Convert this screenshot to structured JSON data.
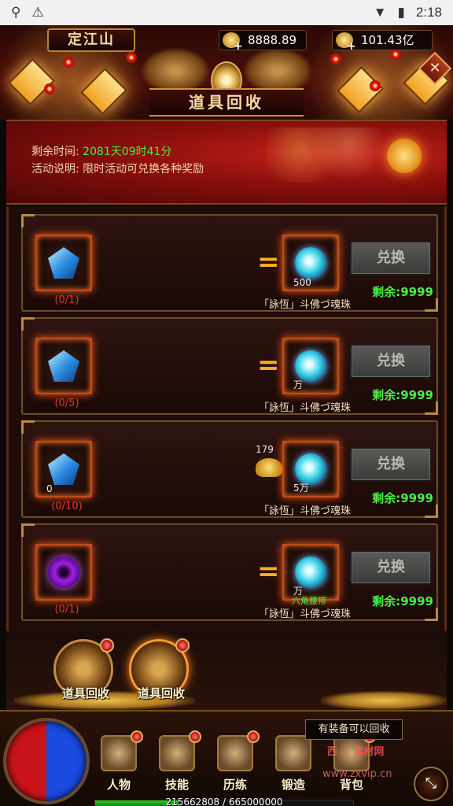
{
  "status_bar": {
    "time": "2:18"
  },
  "header": {
    "server_name": "定江山",
    "currency_1": "8888.89",
    "currency_2": "101.43亿",
    "title": "道具回收",
    "close_glyph": "✕"
  },
  "info": {
    "time_label": "剩余时间:",
    "time_value": "2081天09时41分",
    "desc_label": "活动说明:",
    "desc_value": "限时活动可兑换各种奖励"
  },
  "items": [
    {
      "need": "(0/1)",
      "gem": "gem-blue",
      "slot_qty": "",
      "reward_qty": "500",
      "reward_name": "「詠恆」斗佛づ魂珠",
      "button": "兑换",
      "remain": "剩余:9999"
    },
    {
      "need": "(0/5)",
      "gem": "gem-blue",
      "slot_qty": "",
      "reward_qty": "万",
      "reward_name": "「詠恆」斗佛づ魂珠",
      "button": "兑换",
      "remain": "剩余:9999"
    },
    {
      "need": "(0/10)",
      "gem": "gem-blue",
      "slot_qty": "0",
      "reward_qty": "5万",
      "reward_name": "「詠恆」斗佛づ魂珠",
      "button": "兑换",
      "remain": "剩余:9999",
      "gold_count": "179"
    },
    {
      "need": "(0/1)",
      "gem": "gem-vortex",
      "slot_qty": "",
      "reward_qty": "万",
      "reward_name": "「詠恆」斗佛づ魂珠",
      "button": "兑换",
      "remain": "剩余:9999",
      "belt_label": "六角腰带"
    }
  ],
  "tabs": [
    {
      "label": "道具回收"
    },
    {
      "label": "道具回收"
    }
  ],
  "bottom_bar": {
    "hint": "有装备可以回收",
    "watermark_1": "西 ○ 素材网",
    "watermark_2": "www.zxvip.cn",
    "nav": [
      {
        "label": "人物",
        "icon": "character-icon"
      },
      {
        "label": "技能",
        "icon": "skill-book-icon"
      },
      {
        "label": "历练",
        "icon": "armor-icon"
      },
      {
        "label": "锻造",
        "icon": "anvil-icon"
      },
      {
        "label": "背包",
        "icon": "backpack-icon"
      }
    ],
    "exp_text": "215662808 / 665000000",
    "exp_fraction": 0.324,
    "corner_glyph": "⤡"
  }
}
